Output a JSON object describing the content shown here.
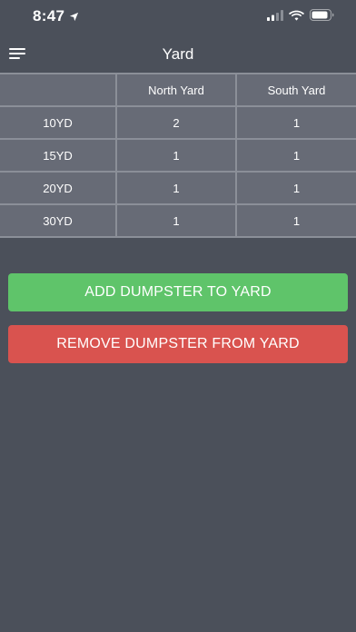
{
  "status_bar": {
    "time": "8:47"
  },
  "nav": {
    "title": "Yard"
  },
  "table": {
    "columns": [
      "",
      "North Yard",
      "South Yard"
    ],
    "rows": [
      {
        "size": "10YD",
        "north": "2",
        "south": "1"
      },
      {
        "size": "15YD",
        "north": "1",
        "south": "1"
      },
      {
        "size": "20YD",
        "north": "1",
        "south": "1"
      },
      {
        "size": "30YD",
        "north": "1",
        "south": "1"
      }
    ]
  },
  "buttons": {
    "add_label": "ADD DUMPSTER TO YARD",
    "remove_label": "REMOVE DUMPSTER FROM YARD"
  },
  "colors": {
    "background": "#4b505a",
    "table_cell": "#676b76",
    "add_button": "#5fc46a",
    "remove_button": "#d9534f"
  },
  "icons": {
    "menu": "hamburger-icon",
    "location": "location-arrow-icon",
    "signal": "cellular-signal-icon",
    "wifi": "wifi-icon",
    "battery": "battery-icon"
  }
}
